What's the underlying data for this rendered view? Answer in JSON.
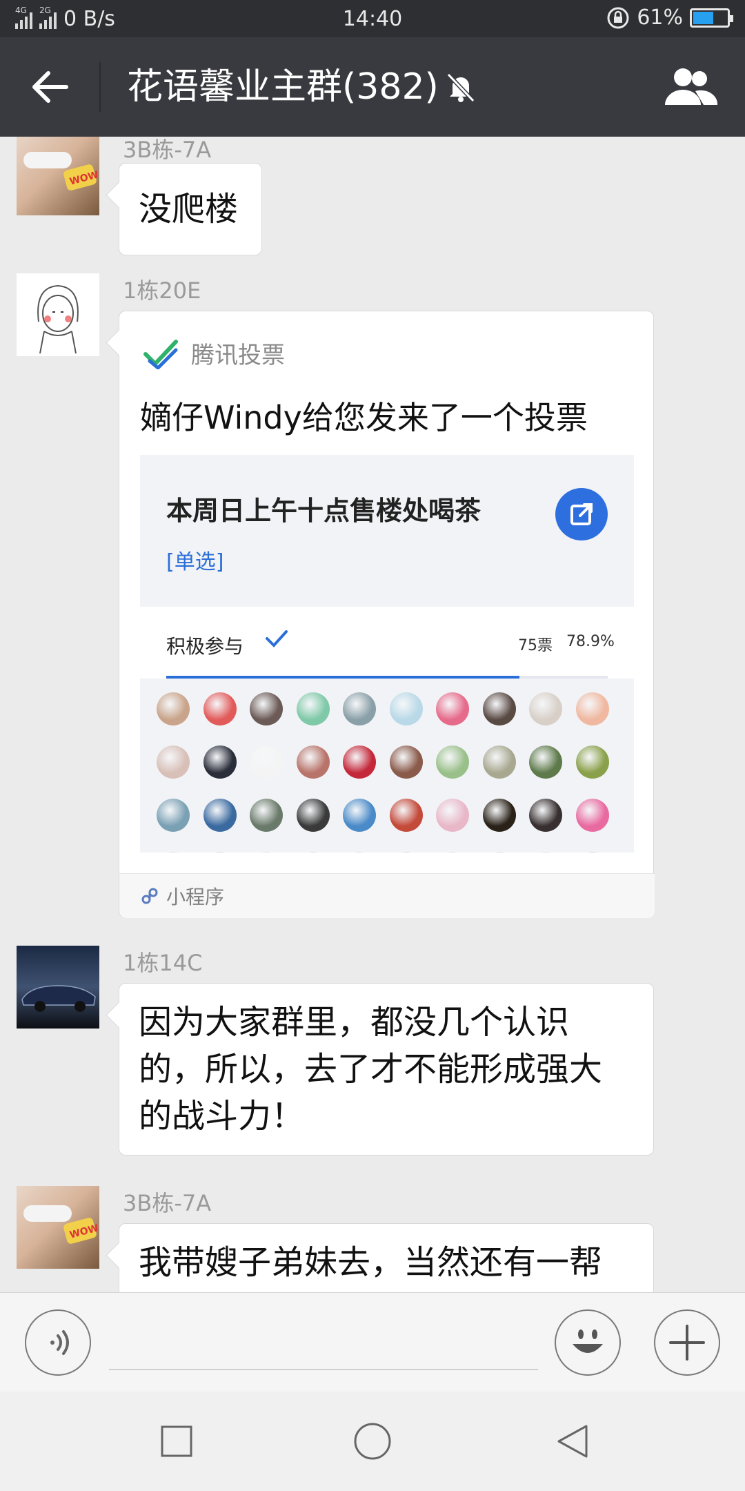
{
  "status_bar": {
    "network1": "4G",
    "network2": "2G",
    "speed": "0 B/s",
    "time": "14:40",
    "battery_text": "61%",
    "battery_level": 0.61,
    "battery_color": "#28a0f0"
  },
  "header": {
    "title": "花语馨业主群(382)",
    "back_icon": "arrow-left-icon",
    "mute_icon": "bell-off-icon",
    "members_icon": "people-icon"
  },
  "messages": [
    {
      "sender": "3B栋-7A",
      "text": "没爬楼"
    },
    {
      "sender": "1栋20E",
      "mini_program": {
        "brand": "腾讯投票",
        "title": "嫡仔Windy给您发来了一个投票",
        "question": "本周日上午十点售楼处喝茶",
        "type": "[单选]",
        "option": "积极参与",
        "votes": "75票",
        "percent": "78.9%",
        "progress": 0.8,
        "footer": "小程序"
      }
    },
    {
      "sender": "1栋14C",
      "text": "因为大家群里，都没几个认识的，所以，去了才不能形成强大的战斗力！"
    },
    {
      "sender": "3B栋-7A",
      "text": "我带嫂子弟妹去，当然还有一帮孩"
    }
  ],
  "input_bar": {
    "voice_icon": "voice-icon",
    "emoji_icon": "emoji-icon",
    "plus_icon": "plus-icon",
    "placeholder": ""
  },
  "nav_bar": {
    "recent_icon": "square-icon",
    "home_icon": "circle-icon",
    "back_icon": "triangle-back-icon"
  },
  "colors": {
    "title_bar": "#393a3f",
    "chat_bg": "#ebebeb",
    "accent_blue": "#2a6ed8"
  }
}
